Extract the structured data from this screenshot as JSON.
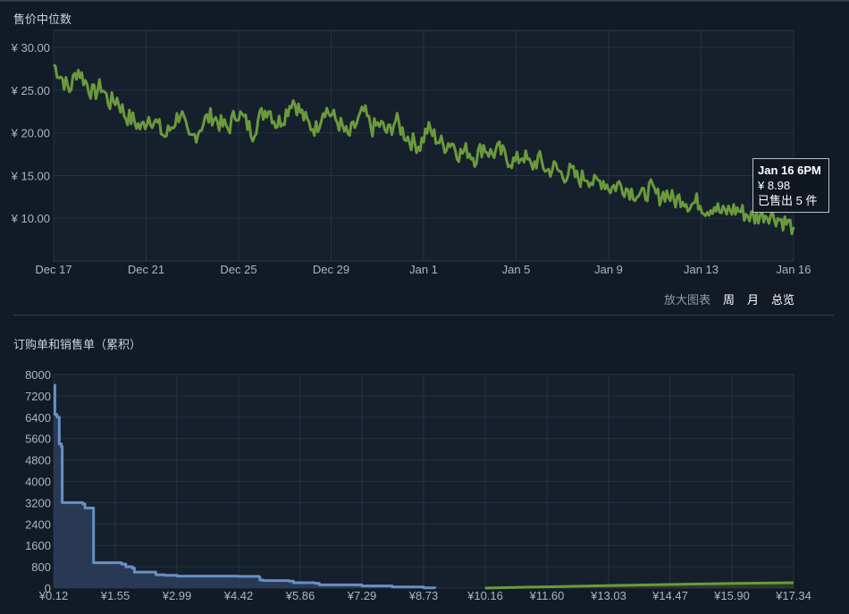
{
  "median_chart": {
    "title": "售价中位数",
    "x_ticks": [
      "Dec 17",
      "Dec 21",
      "Dec 25",
      "Dec 29",
      "Jan 1",
      "Jan 5",
      "Jan 9",
      "Jan 13",
      "Jan 16"
    ],
    "y_ticks": [
      "¥ 10.00",
      "¥ 15.00",
      "¥ 20.00",
      "¥ 25.00",
      "¥ 30.00"
    ],
    "zoom": {
      "label": "放大图表",
      "week": "周",
      "month": "月",
      "overview": "总览"
    },
    "tooltip": {
      "date": "Jan 16 6PM",
      "price": "¥ 8.98",
      "sold": "已售出 5 件"
    },
    "line_color": "#6b9a3c"
  },
  "orders_chart": {
    "title": "订购单和销售单（累积）",
    "y_ticks": [
      "0",
      "800",
      "1600",
      "2400",
      "3200",
      "4000",
      "4800",
      "5600",
      "6400",
      "7200",
      "8000"
    ],
    "x_ticks": [
      "¥0.12",
      "¥1.55",
      "¥2.99",
      "¥4.42",
      "¥5.86",
      "¥7.29",
      "¥8.73",
      "¥10.16",
      "¥11.60",
      "¥13.03",
      "¥14.47",
      "¥15.90",
      "¥17.34"
    ],
    "buy_color": "#688fc6",
    "sell_color": "#6b9a3c"
  },
  "chart_data": [
    {
      "type": "line",
      "title": "售价中位数",
      "xlabel": "",
      "ylabel": "",
      "ylim": [
        5,
        32
      ],
      "x_range": [
        "Dec 17",
        "Jan 16"
      ],
      "series": [
        {
          "values": [
            28.0,
            26.5,
            25.0,
            27.5,
            26.0,
            24.5,
            25.5,
            23.5,
            24.0,
            22.0,
            21.5,
            20.5,
            22.0,
            21.0,
            19.5,
            21.0,
            22.5,
            19.0,
            20.0,
            21.5,
            22.0,
            21.0,
            20.5,
            22.5,
            21.5,
            20.0,
            22.0,
            23.0,
            21.0,
            22.0,
            24.0,
            22.5,
            21.0,
            20.5,
            23.0,
            22.0,
            21.0,
            19.5,
            21.0,
            22.5,
            20.5,
            21.0,
            20.0,
            21.5,
            20.0,
            19.0,
            18.5,
            20.5,
            19.5,
            18.5,
            19.0,
            17.5,
            18.0,
            17.0,
            18.5,
            17.5,
            18.0,
            17.0,
            16.5,
            17.5,
            16.0,
            17.0,
            15.5,
            16.0,
            15.0,
            15.5,
            14.5,
            15.0,
            14.0,
            14.5,
            13.5,
            14.0,
            13.5,
            13.0,
            12.5,
            13.5,
            12.5,
            13.0,
            12.0,
            12.5,
            11.5,
            12.0,
            11.0,
            11.5,
            10.5,
            11.0,
            11.0,
            10.5,
            10.0,
            10.5,
            10.5,
            10.0,
            9.5,
            8.98
          ]
        }
      ]
    },
    {
      "type": "area",
      "title": "订购单和销售单（累积）",
      "xlim": [
        0.12,
        17.34
      ],
      "ylim": [
        0,
        8000
      ],
      "series": [
        {
          "name": "",
          "points": [
            [
              0.12,
              7600
            ],
            [
              0.15,
              6500
            ],
            [
              0.2,
              6400
            ],
            [
              0.25,
              5400
            ],
            [
              0.3,
              5300
            ],
            [
              0.32,
              3200
            ],
            [
              0.4,
              3200
            ],
            [
              0.8,
              3150
            ],
            [
              0.85,
              3000
            ],
            [
              1.0,
              3000
            ],
            [
              1.05,
              950
            ],
            [
              1.2,
              950
            ],
            [
              1.7,
              900
            ],
            [
              1.8,
              800
            ],
            [
              1.95,
              750
            ],
            [
              2.0,
              600
            ],
            [
              2.45,
              600
            ],
            [
              2.5,
              500
            ],
            [
              2.7,
              480
            ],
            [
              3.0,
              450
            ],
            [
              4.42,
              440
            ],
            [
              4.9,
              420
            ],
            [
              4.92,
              300
            ],
            [
              5.0,
              280
            ],
            [
              5.6,
              260
            ],
            [
              5.7,
              200
            ],
            [
              6.2,
              180
            ],
            [
              6.3,
              120
            ],
            [
              7.29,
              80
            ],
            [
              8.0,
              40
            ],
            [
              8.73,
              10
            ],
            [
              9.0,
              0
            ]
          ]
        },
        {
          "name": "",
          "points": [
            [
              10.16,
              0
            ],
            [
              11.0,
              30
            ],
            [
              12.0,
              60
            ],
            [
              13.0,
              90
            ],
            [
              14.0,
              120
            ],
            [
              15.0,
              150
            ],
            [
              16.0,
              175
            ],
            [
              17.34,
              200
            ]
          ]
        }
      ]
    }
  ]
}
